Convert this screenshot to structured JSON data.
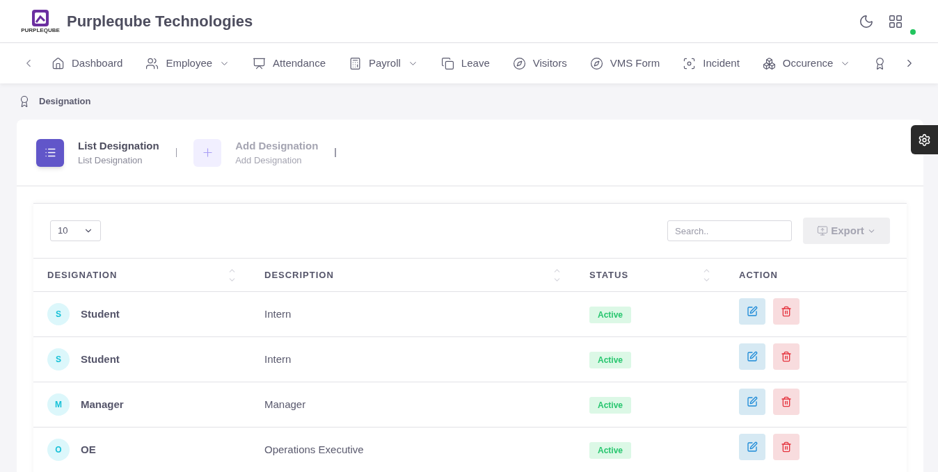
{
  "header": {
    "logo_text": "PURPLEQUBE",
    "title": "Purpleqube Technologies",
    "online": true
  },
  "nav": [
    {
      "label": "Dashboard",
      "kind": "home",
      "dropdown": false
    },
    {
      "label": "Employee",
      "kind": "users",
      "dropdown": true
    },
    {
      "label": "Attendance",
      "kind": "monitor",
      "dropdown": false
    },
    {
      "label": "Payroll",
      "kind": "calculator",
      "dropdown": true
    },
    {
      "label": "Leave",
      "kind": "copy",
      "dropdown": false
    },
    {
      "label": "Visitors",
      "kind": "compass",
      "dropdown": false
    },
    {
      "label": "VMS Form",
      "kind": "compass",
      "dropdown": false
    },
    {
      "label": "Incident",
      "kind": "focus",
      "dropdown": false
    },
    {
      "label": "Occurence",
      "kind": "boxes",
      "dropdown": true
    },
    {
      "kind": "award",
      "dropdown": false
    }
  ],
  "breadcrumb": "Designation",
  "tabs": [
    {
      "title": "List Designation",
      "subtitle": "List Designation",
      "kind": "list",
      "selected": true
    },
    {
      "title": "Add Designation",
      "subtitle": "Add Designation",
      "kind": "add",
      "selected": false
    }
  ],
  "toolbar": {
    "page_size": "10",
    "search_placeholder": "Search..",
    "export": "Export"
  },
  "table": {
    "columns": [
      {
        "label": "DESIGNATION",
        "sortable": true
      },
      {
        "label": "DESCRIPTION",
        "sortable": true
      },
      {
        "label": "STATUS",
        "sortable": true
      },
      {
        "label": "ACTION",
        "sortable": false
      }
    ],
    "rows": [
      {
        "initial": "S",
        "designation": "Student",
        "description": "Intern",
        "status": "Active"
      },
      {
        "initial": "S",
        "designation": "Student",
        "description": "Intern",
        "status": "Active"
      },
      {
        "initial": "M",
        "designation": "Manager",
        "description": "Manager",
        "status": "Active"
      },
      {
        "initial": "O",
        "designation": "OE",
        "description": "Operations Executive",
        "status": "Active"
      }
    ]
  }
}
